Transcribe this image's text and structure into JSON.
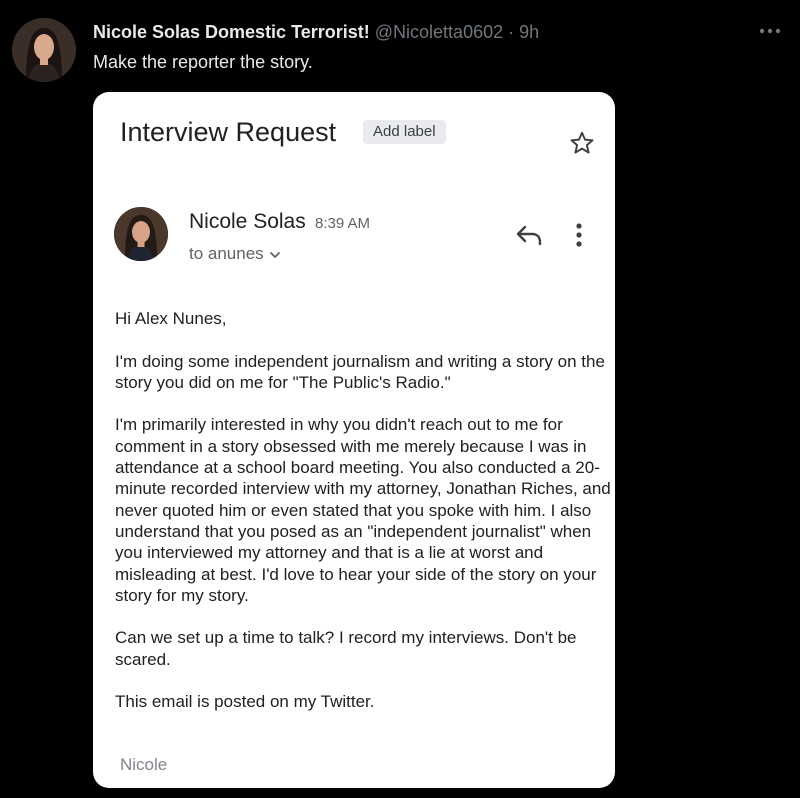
{
  "tweet": {
    "display_name": "Nicole Solas Domestic Terrorist!",
    "handle": "@Nicoletta0602",
    "separator": "·",
    "time": "9h",
    "text": "Make the reporter the story."
  },
  "email": {
    "subject": "Interview Request",
    "label_button": "Add label",
    "sender_name": "Nicole Solas",
    "sent_time": "8:39 AM",
    "recipient": "to anunes",
    "body": {
      "greeting": "Hi Alex Nunes,",
      "p1": "I'm doing some independent journalism and writing a story on the story you did on me for \"The Public's Radio.\"",
      "p2": "I'm primarily interested in why you didn't reach out to me for comment in a story obsessed with me merely because I was in attendance at a school board meeting. You also conducted a 20-minute recorded interview with my attorney, Jonathan Riches, and never quoted him or even stated that you spoke with him. I also understand that you posed as an \"independent journalist\" when you interviewed my attorney and that is a lie at worst and misleading at best. I'd love to hear your side of the story on your story for my story.",
      "p3": "Can we set up a time to talk? I record my interviews. Don't be scared.",
      "p4": "This email is posted on my Twitter."
    },
    "signature": "Nicole"
  },
  "icons": {
    "tweet_more": "more-horizontal-icon",
    "star": "star-outline-icon",
    "reply": "reply-arrow-icon",
    "email_more": "more-vertical-icon",
    "recipient_toggle": "chevron-down-icon"
  },
  "colors": {
    "background": "#000000",
    "primary_text": "#e7e9ea",
    "secondary_text": "#71767b",
    "card": "#ffffff",
    "email_text": "#202124",
    "email_muted": "#5f6368",
    "chip": "#e8eaed"
  }
}
